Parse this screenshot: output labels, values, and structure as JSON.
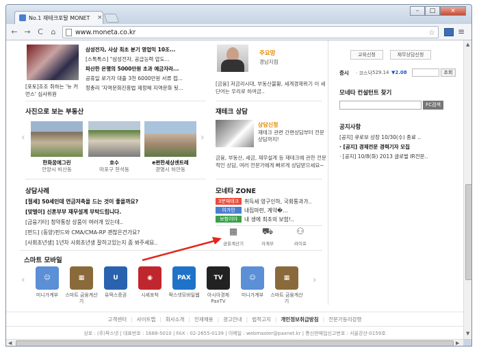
{
  "browser": {
    "tab_title": "No.1 재테크포탈 MONET",
    "tab_close": "×",
    "url": "www.moneta.co.kr",
    "back": "←",
    "forward": "→",
    "reload": "C",
    "home": "⌂",
    "star": "☆",
    "menu": "≡",
    "min": "–",
    "max": "□",
    "close": "×"
  },
  "news": {
    "caption": "[포토]조조 취하는 '뉴 커먼스' 심사위원",
    "lines": [
      "삼성전자, 사상 최초 분기 영업익 10조...",
      "[스톡톡스] \"삼성전자, 공급능력 압도...",
      "파산한 은행의 5000만원 초과 예금자라...",
      "공휴일 로기자 대출 3천 6000만원 서류 접...",
      "정총리 '지역문화진흥법 제정해 지역문화 됫..."
    ]
  },
  "person": {
    "name": "주요망",
    "role": "경남지점",
    "desc": "[금융] 저금리시대, 부동산불황, 세계경제위기 이 세단어는 우리로 하여금.."
  },
  "gallery": {
    "title": "사진으로 보는 부동산",
    "items": [
      {
        "name": "한화꿈에그린",
        "sub": "안양시 비산동"
      },
      {
        "name": "호수",
        "sub": "마포구 현석동"
      },
      {
        "name": "e편한세상센트레",
        "sub": "광명시 하안동"
      }
    ],
    "prev": "‹",
    "next": "›"
  },
  "tech": {
    "title": "재테크 상담",
    "tag": "상담신청",
    "desc": "재테크 관련 간편상담부터 전문상담까지!",
    "body": "금융, 부동산, 세금, 재무설계 등 재테크에 관한 전문적인 상담, 여러 전문가에게 빠르게 상담받으세요~"
  },
  "consult": {
    "title": "상담사례",
    "lines": [
      "[절세] 50세인데 연금저축을 드는 것이 좋을까요?",
      "[맞벌이] 신혼부부 재무설계 부탁드립니다.",
      "[금융기타] 청약통장 상품이 여러개 있는데..",
      "[펀드] (동양)펀드와 CMA/CMA-RP 괜찮은건가요?",
      "[사회초년생] 1년차 사회초년생 잘하고있는지 좀 봐주세요.."
    ]
  },
  "zone": {
    "title": "모네타 ZONE",
    "items": [
      {
        "badge": "3분재테크",
        "color": "#e84c3d",
        "text": "취득세 영구인하, 국회통과가.."
      },
      {
        "badge": "이가인",
        "color": "#4a7fd0",
        "text": "내집마련, 계약�..."
      },
      {
        "badge": "보험이야기",
        "color": "#3aa04a",
        "text": "내 생에 최초의 보험!.."
      }
    ]
  },
  "tools": [
    {
      "label": "금융계산기",
      "icon": "calculator-icon",
      "glyph": "▦"
    },
    {
      "label": "자계부",
      "icon": "car-icon",
      "glyph": "⛟"
    },
    {
      "label": "라이프",
      "icon": "network-icon",
      "glyph": "⚇"
    }
  ],
  "mobile": {
    "title": "스마트 모바일",
    "apps": [
      {
        "label": "미니가계부",
        "glyph": "☺",
        "color": "#5b8fd6"
      },
      {
        "label": "스마트 금융계산기",
        "glyph": "▦",
        "color": "#8a6a3a"
      },
      {
        "label": "유팍스증권",
        "glyph": "U",
        "color": "#2a62b0"
      },
      {
        "label": "시세포착",
        "glyph": "◉",
        "color": "#c0262d"
      },
      {
        "label": "팍스넷모바일웹",
        "glyph": "PAX",
        "color": "#1e73c8"
      },
      {
        "label": "아시아경제 PaxTV",
        "glyph": "TV",
        "color": "#222"
      },
      {
        "label": "미니가계부",
        "glyph": "☺",
        "color": "#5b8fd6"
      },
      {
        "label": "스마트 금융계산기",
        "glyph": "▦",
        "color": "#8a6a3a"
      }
    ]
  },
  "right": {
    "btn_edu": "교육신청",
    "btn_consult": "재무상담신청",
    "index_label": "증시",
    "index_name": "· 코스닥",
    "index_value": "529.14",
    "index_change": "▼2.08",
    "search_btn": "조회",
    "consultant_title": "모네타 컨설턴트 찾기",
    "consultant_btn": "FC검색",
    "notice_title": "공지사항",
    "notices": [
      "[공지] 큐로보 상장 10/30(수) 종료 ..",
      "· [공지] 경제전문 경력기자 모집",
      "· [공지] 10/8(화) 2013 글로벌 IR전문.."
    ]
  },
  "footer": {
    "links": [
      "고객센터",
      "사이트맵",
      "회사소개",
      "인재채용",
      "광고안내",
      "법적고지",
      "개인정보취급방침",
      "전문가등리강령"
    ],
    "info": "상호 : (주)팍스넷  |  대표번호 : 1688-5010  |  FAX : 02-2655-0139  |  이메일 : webmaster@paxnet.kr  |  통신판매업신고번호 : 서울강산-0159호"
  }
}
